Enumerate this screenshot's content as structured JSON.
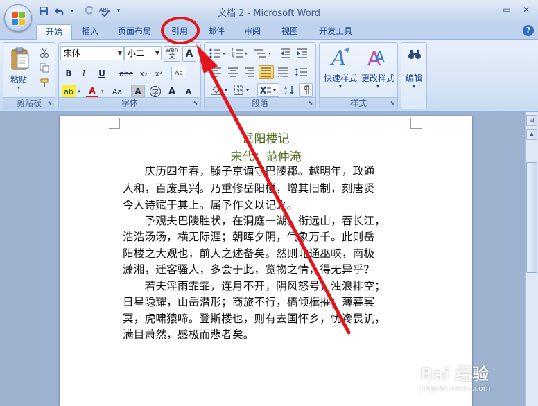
{
  "window": {
    "title": "文档 2 - Microsoft Word",
    "controls": {
      "minimize": "–",
      "restore": "▭",
      "close": "✕"
    }
  },
  "quick_access": {
    "save_icon": "floppy-disk-icon",
    "undo_icon": "undo-icon",
    "redo_icon": "redo-icon",
    "format_icon": "format-painter-abc-icon",
    "customize_icon": "chevron-down-icon"
  },
  "tabs": [
    {
      "label": "开始",
      "active": true
    },
    {
      "label": "插入"
    },
    {
      "label": "页面布局"
    },
    {
      "label": "引用",
      "highlighted": true
    },
    {
      "label": "邮件"
    },
    {
      "label": "审阅"
    },
    {
      "label": "视图"
    },
    {
      "label": "开发工具"
    }
  ],
  "help_label": "?",
  "ribbon": {
    "clipboard": {
      "label": "剪贴板",
      "paste_label": "粘贴"
    },
    "font": {
      "label": "字体",
      "font_name": "宋体",
      "font_size": "小二",
      "phonetic_label": "wén 文",
      "border_char": "A",
      "bold": "B",
      "italic": "I",
      "underline": "U",
      "strike": "abc",
      "subscript": "x₂",
      "superscript": "x²",
      "clear_format": "Aa",
      "highlight": "ab",
      "font_color": "A",
      "change_case": "Aa",
      "shading": "A",
      "enclose": "字",
      "grow": "A",
      "shrink": "A"
    },
    "paragraph": {
      "label": "段落"
    },
    "styles": {
      "label": "样式",
      "quick_styles": "快速样式",
      "change_styles": "更改样式"
    },
    "editing": {
      "label": "编辑"
    }
  },
  "document": {
    "title": "岳阳楼记",
    "subtitle": "宋代：范仲淹",
    "lines": [
      "　　庆历四年春，滕子京谪守巴陵郡。越明年，政通",
      "人和，百废具兴。乃重修岳阳楼，增其旧制，刻唐贤",
      "今人诗赋于其上。属予作文以记之。",
      "　　予观夫巴陵胜状，在洞庭一湖。衔远山，吞长江，",
      "浩浩汤汤，横无际涯；朝晖夕阴，气象万千。此则岳",
      "阳楼之大观也，前人之述备矣。然则北通巫峡，南极",
      "潇湘，迁客骚人，多会于此，览物之情，得无异乎？",
      "　　若夫淫雨霏霏，连月不开，阴风怒号，浊浪排空；",
      "日星隐耀，山岳潜形；商旅不行，樯倾楫摧；薄暮冥",
      "冥，虎啸猿啼。登斯楼也，则有去国怀乡，忧谗畏讥，",
      "满目萧然，感极而悲者矣。"
    ]
  },
  "watermark": {
    "main": "Bai 经验",
    "sub": "jingyan.baidu.com"
  },
  "colors": {
    "annotation": "#e3141c",
    "ribbon_blue": "#15428b",
    "title_green": "#4d6d1f"
  }
}
